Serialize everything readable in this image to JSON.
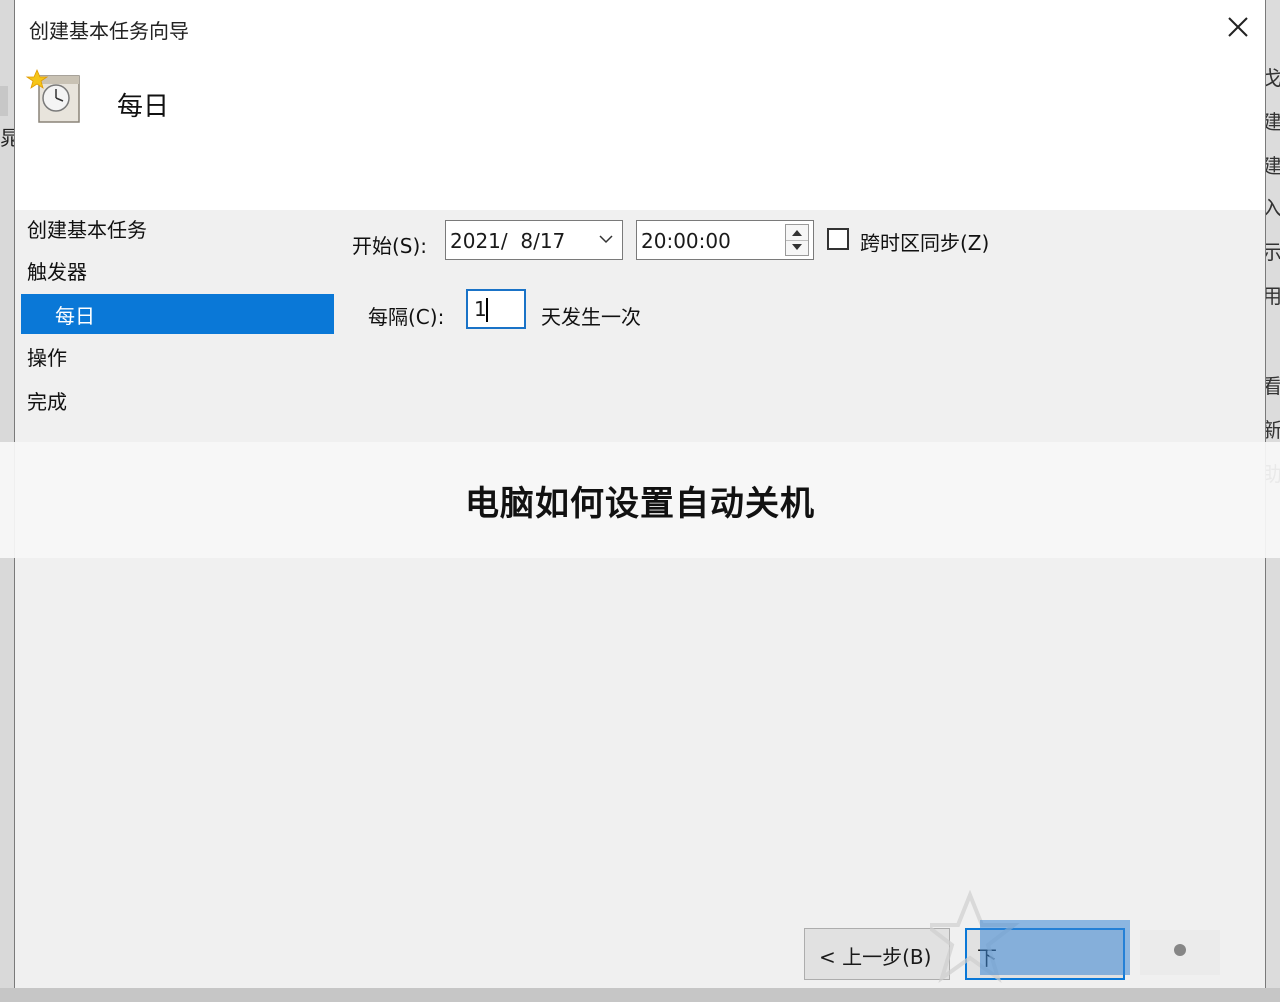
{
  "window": {
    "title": "创建基本任务向导",
    "close_label": "关闭"
  },
  "header": {
    "title": "每日",
    "icon": "clock-schedule-icon"
  },
  "nav": {
    "items": [
      {
        "label": "创建基本任务",
        "active": false
      },
      {
        "label": "触发器",
        "active": false
      },
      {
        "label": "每日",
        "active": true
      },
      {
        "label": "操作",
        "active": false
      },
      {
        "label": "完成",
        "active": false
      }
    ]
  },
  "form": {
    "start_label": "开始(S):",
    "start_date": "2021/  8/17",
    "start_time": "20:00:00",
    "sync_timezone_label": "跨时区同步(Z)",
    "sync_timezone_checked": false,
    "recur_label": "每隔(C):",
    "recur_value": "1",
    "recur_suffix": "天发生一次"
  },
  "buttons": {
    "back": "< 上一步(B)",
    "next": "下"
  },
  "overlay": {
    "caption": "电脑如何设置自动关机"
  },
  "background": {
    "left_fragment": "晁",
    "right_fragments": [
      "戈",
      "建",
      "建",
      "入",
      "示",
      "用",
      "看",
      "新",
      "助"
    ]
  },
  "colors": {
    "accent": "#0a78d7",
    "window_bg": "#f0f0f0",
    "header_bg": "#ffffff"
  }
}
